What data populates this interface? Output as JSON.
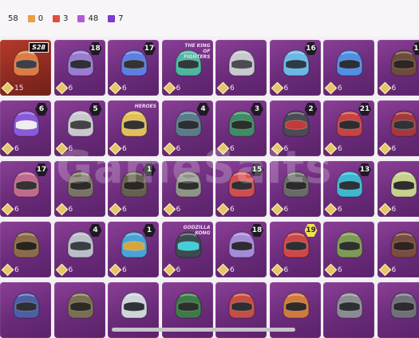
{
  "header": {
    "total": "58",
    "counts": [
      {
        "color": "#e9a040",
        "value": "0"
      },
      {
        "color": "#e24d3a",
        "value": "3"
      },
      {
        "color": "#b25ad6",
        "value": "48"
      },
      {
        "color": "#7a3bd0",
        "value": "7"
      }
    ]
  },
  "watermark": "GameSalts",
  "items": [
    {
      "lv": "15",
      "badge": "S28",
      "badge_type": "tag",
      "theme": "red",
      "helmet": "#dc7b45",
      "visor": "#3f3f46"
    },
    {
      "lv": "6",
      "badge": "18",
      "badge_type": "level",
      "theme": "purple",
      "helmet": "#9a7cd2",
      "visor": "#2f2f39"
    },
    {
      "lv": "6",
      "badge": "17",
      "badge_type": "level",
      "theme": "purple",
      "helmet": "#5d7ee3",
      "visor": "#333"
    },
    {
      "lv": "6",
      "badge": "",
      "badge_type": "brand",
      "brand": "THE KING OF FIGHTERS",
      "theme": "purple",
      "helmet": "#4bb99e",
      "visor": "#2e3a3b"
    },
    {
      "lv": "6",
      "badge": "",
      "badge_type": "none",
      "theme": "purple",
      "helmet": "#c7c9cf",
      "visor": "#4a4c52"
    },
    {
      "lv": "6",
      "badge": "16",
      "badge_type": "level",
      "theme": "purple",
      "helmet": "#6bb8e6",
      "visor": "#2b3b47"
    },
    {
      "lv": "6",
      "badge": "",
      "badge_type": "none",
      "theme": "purple",
      "helmet": "#4f8fe6",
      "visor": "#2b2f37"
    },
    {
      "lv": "6",
      "badge": "10",
      "badge_type": "level",
      "theme": "purple",
      "helmet": "#6f4b3d",
      "visor": "#2d2623"
    },
    {
      "lv": "6",
      "badge": "6",
      "badge_type": "level",
      "theme": "purple",
      "helmet": "#8a5ad8",
      "visor": "#eeeeee"
    },
    {
      "lv": "6",
      "badge": "5",
      "badge_type": "level",
      "theme": "purple",
      "helmet": "#c8c8ce",
      "visor": "#444"
    },
    {
      "lv": "6",
      "badge": "",
      "badge_type": "brand",
      "brand": "HEROES",
      "theme": "purple",
      "helmet": "#e1c05a",
      "visor": "#333"
    },
    {
      "lv": "6",
      "badge": "4",
      "badge_type": "level",
      "theme": "purple",
      "helmet": "#5a7c8a",
      "visor": "#2a2f33"
    },
    {
      "lv": "6",
      "badge": "3",
      "badge_type": "level",
      "theme": "purple",
      "helmet": "#3f8c66",
      "visor": "#283029"
    },
    {
      "lv": "6",
      "badge": "2",
      "badge_type": "level",
      "theme": "purple",
      "helmet": "#4b4b53",
      "visor": "#c23a3a"
    },
    {
      "lv": "6",
      "badge": "21",
      "badge_type": "level",
      "theme": "purple",
      "helmet": "#c84343",
      "visor": "#2d2d31"
    },
    {
      "lv": "6",
      "badge": "",
      "badge_type": "none",
      "theme": "purple",
      "helmet": "#a3393e",
      "visor": "#2f3338"
    },
    {
      "lv": "6",
      "badge": "17",
      "badge_type": "level",
      "theme": "purple",
      "helmet": "#c06a8e",
      "visor": "#333"
    },
    {
      "lv": "6",
      "badge": "",
      "badge_type": "none",
      "theme": "purple",
      "helmet": "#7a7466",
      "visor": "#2d2b28"
    },
    {
      "lv": "6",
      "badge": "1",
      "badge_type": "level",
      "theme": "purple",
      "helmet": "#66604f",
      "visor": "#2a2823"
    },
    {
      "lv": "6",
      "badge": "",
      "badge_type": "none",
      "theme": "purple",
      "helmet": "#8f9388",
      "visor": "#2c2e2a"
    },
    {
      "lv": "6",
      "badge": "15",
      "badge_type": "level",
      "theme": "purple",
      "helmet": "#d24d4f",
      "visor": "#2f2f33"
    },
    {
      "lv": "6",
      "badge": "",
      "badge_type": "none",
      "theme": "purple",
      "helmet": "#6a6a68",
      "visor": "#2b2b2b"
    },
    {
      "lv": "6",
      "badge": "13",
      "badge_type": "level",
      "theme": "purple",
      "helmet": "#3fb7d0",
      "visor": "#2b3338"
    },
    {
      "lv": "6",
      "badge": "",
      "badge_type": "none",
      "theme": "purple",
      "helmet": "#c8d08f",
      "visor": "#2d2d2b"
    },
    {
      "lv": "6",
      "badge": "",
      "badge_type": "none",
      "theme": "purple",
      "helmet": "#8b6c4a",
      "visor": "#2a241d"
    },
    {
      "lv": "6",
      "badge": "4",
      "badge_type": "level",
      "theme": "purple",
      "helmet": "#b9bec8",
      "visor": "#3a3f46"
    },
    {
      "lv": "6",
      "badge": "1",
      "badge_type": "level",
      "theme": "purple",
      "helmet": "#4aa3d6",
      "visor": "#d6a63d"
    },
    {
      "lv": "6",
      "badge": "",
      "badge_type": "brand",
      "brand": "GODZILLA KONG",
      "theme": "purple",
      "helmet": "#3b4b4f",
      "visor": "#3fd0d9"
    },
    {
      "lv": "6",
      "badge": "18",
      "badge_type": "level",
      "theme": "purple",
      "helmet": "#a48bd8",
      "visor": "#2d2b33"
    },
    {
      "lv": "6",
      "badge": "19",
      "badge_type": "gold",
      "theme": "purple",
      "helmet": "#cf4848",
      "visor": "#2f2f33"
    },
    {
      "lv": "6",
      "badge": "",
      "badge_type": "none",
      "theme": "purple",
      "helmet": "#7e9a55",
      "visor": "#2d332a"
    },
    {
      "lv": "6",
      "badge": "",
      "badge_type": "none",
      "theme": "purple",
      "helmet": "#7a4d3e",
      "visor": "#2e2421"
    },
    {
      "lv": "",
      "badge": "",
      "badge_type": "none",
      "theme": "purple",
      "helmet": "#4c5fa6",
      "visor": "#2d2f36"
    },
    {
      "lv": "",
      "badge": "",
      "badge_type": "none",
      "theme": "purple",
      "helmet": "#7a6f52",
      "visor": "#2d2a23"
    },
    {
      "lv": "",
      "badge": "",
      "badge_type": "none",
      "theme": "purple",
      "helmet": "#cfd3da",
      "visor": "#2f3338"
    },
    {
      "lv": "",
      "badge": "",
      "badge_type": "none",
      "theme": "purple",
      "helmet": "#3e7a4a",
      "visor": "#2a312b"
    },
    {
      "lv": "",
      "badge": "",
      "badge_type": "none",
      "theme": "purple",
      "helmet": "#c44f46",
      "visor": "#2f2f33"
    },
    {
      "lv": "",
      "badge": "",
      "badge_type": "none",
      "theme": "purple",
      "helmet": "#d07a3d",
      "visor": "#2f2b26"
    },
    {
      "lv": "",
      "badge": "",
      "badge_type": "none",
      "theme": "purple",
      "helmet": "#8b8c92",
      "visor": "#2d2f33"
    },
    {
      "lv": "",
      "badge": "",
      "badge_type": "none",
      "theme": "purple",
      "helmet": "#70707a",
      "visor": "#2b2b30"
    }
  ]
}
